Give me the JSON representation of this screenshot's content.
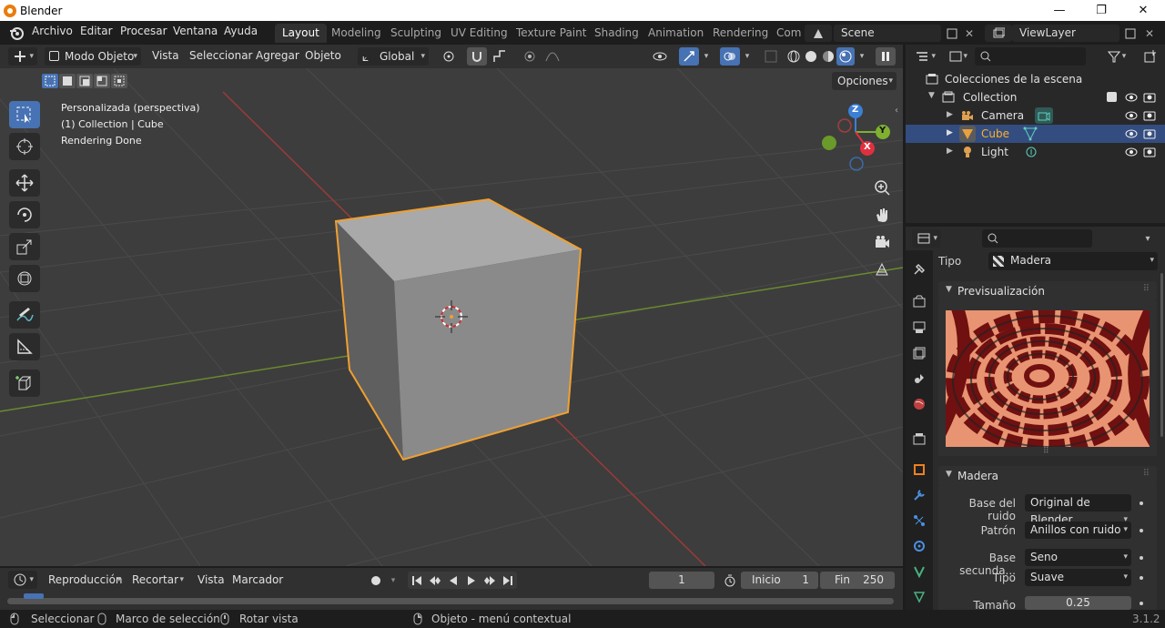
{
  "window": {
    "title": "Blender",
    "minimize": "—",
    "maximize": "❐",
    "close": "✕"
  },
  "menu": {
    "items": [
      "Archivo",
      "Editar",
      "Procesar",
      "Ventana",
      "Ayuda"
    ]
  },
  "workspaces": {
    "tabs": [
      "Layout",
      "Modeling",
      "Sculpting",
      "UV Editing",
      "Texture Paint",
      "Shading",
      "Animation",
      "Rendering",
      "Com"
    ],
    "active": "Layout"
  },
  "scene": {
    "name": "Scene"
  },
  "viewlayer": {
    "name": "ViewLayer"
  },
  "viewport_header": {
    "mode": "Modo Objeto",
    "menus": [
      "Vista",
      "Seleccionar",
      "Agregar",
      "Objeto"
    ],
    "transform_orientation": "Global",
    "options_label": "Opciones"
  },
  "viewport_overlay": {
    "line1": "Personalizada (perspectiva)",
    "line2": "(1) Collection | Cube",
    "line3": "Rendering Done"
  },
  "gizmo": {
    "z": "Z",
    "y": "Y",
    "x": "X"
  },
  "outliner": {
    "root": "Colecciones de la escena",
    "collection": "Collection",
    "items": [
      {
        "name": "Camera",
        "selected": false,
        "color": "#e0a050"
      },
      {
        "name": "Cube",
        "selected": true,
        "color": "#e8a040"
      },
      {
        "name": "Light",
        "selected": false,
        "color": "#e0a050"
      }
    ]
  },
  "properties": {
    "type_label": "Tipo",
    "type_value": "Madera",
    "preview_panel": "Previsualización",
    "wood_panel": "Madera",
    "fields": [
      {
        "label": "Base del ruido",
        "value": "Original de Blender"
      },
      {
        "label": "Patrón",
        "value": "Anillos con ruido"
      },
      {
        "label": "Base secunda...",
        "value": "Seno"
      },
      {
        "label": "Tipo",
        "value": "Suave"
      },
      {
        "label": "Tamaño",
        "value": "0.25"
      }
    ]
  },
  "timeline": {
    "menus": [
      "Reproducción",
      "Recortar",
      "Vista",
      "Marcador"
    ],
    "current_frame": "1",
    "start_label": "Inicio",
    "start_value": "1",
    "end_label": "Fin",
    "end_value": "250"
  },
  "statusbar": {
    "items": [
      "Seleccionar",
      "Marco de selección",
      "Rotar vista",
      "Objeto - menú contextual"
    ],
    "version": "3.1.2"
  },
  "colors": {
    "accent": "#4772b3",
    "selection_outline": "#f0a030",
    "active_tab": "#303030"
  }
}
